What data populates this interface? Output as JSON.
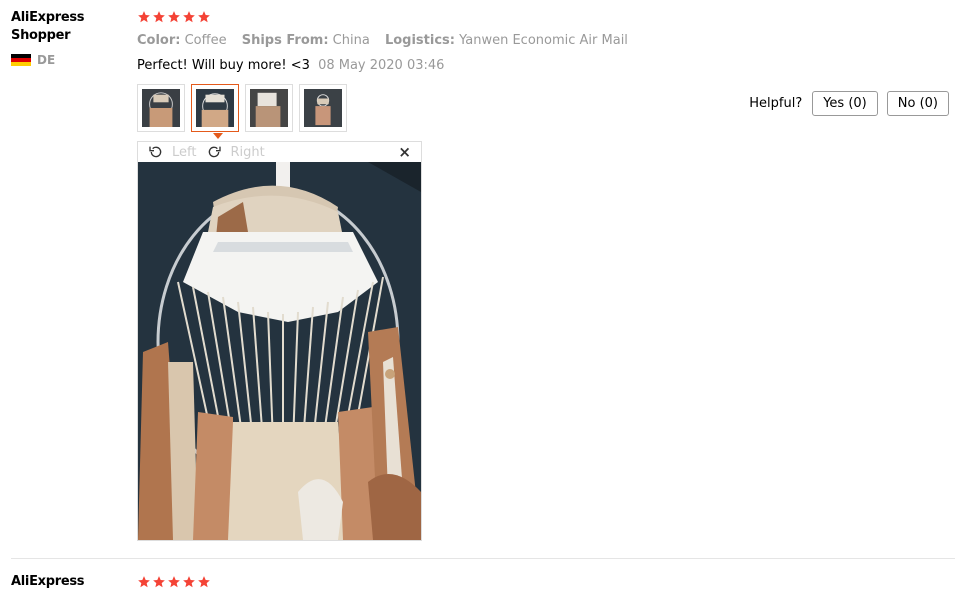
{
  "review1": {
    "user": "AliExpress Shopper",
    "country": "DE",
    "rating": 5,
    "meta": [
      {
        "label": "Color:",
        "value": "Coffee"
      },
      {
        "label": "Ships From:",
        "value": "China"
      },
      {
        "label": "Logistics:",
        "value": "Yanwen Economic Air Mail"
      }
    ],
    "text": "Perfect! Will buy more! <3",
    "date": "08 May 2020 03:46",
    "helpful_label": "Helpful?",
    "yes_label": "Yes (0)",
    "no_label": "No (0)",
    "viewer": {
      "left_label": "Left",
      "right_label": "Right",
      "close_label": "×"
    }
  },
  "review2": {
    "user": "AliExpress",
    "rating": 5
  },
  "colors": {
    "star": "#f44336",
    "accent": "#e45a1b",
    "muted": "#999999"
  }
}
